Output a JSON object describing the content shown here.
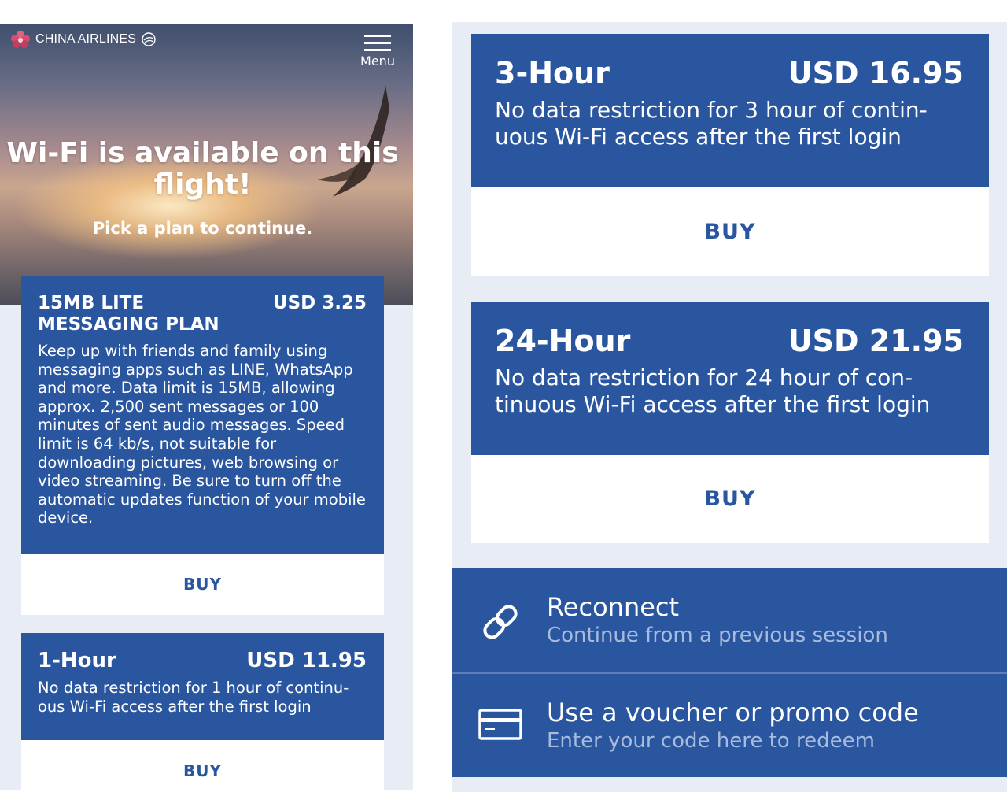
{
  "app": {
    "brand": "CHINA AIRLINES",
    "menu_label": "Menu"
  },
  "hero": {
    "title": "Wi-Fi is available on this flight!",
    "subtitle": "Pick a plan to continue."
  },
  "plans": [
    {
      "name": "15MB LITE MESSAGING PLAN",
      "price": "USD 3.25",
      "description": "Keep up with friends and family using messaging apps such as LINE, WhatsApp and more. Data limit is 15MB, allowing approx. 2,500 sent messages or 100 minutes of sent audio messages. Speed limit is 64 kb/s, not suitable for downloading pictures, web browsing or video streaming. Be sure to turn off the automatic updates function of your mobile device.",
      "buy_label": "BUY"
    },
    {
      "name": "1-Hour",
      "price": "USD 11.95",
      "description": "No data restriction for 1 hour of continu-ous Wi-Fi access after the first login",
      "buy_label": "BUY"
    },
    {
      "name": "3-Hour",
      "price": "USD 16.95",
      "description": "No data restriction for 3 hour of contin-uous Wi-Fi access after the first login",
      "buy_label": "BUY"
    },
    {
      "name": "24-Hour",
      "price": "USD 21.95",
      "description": "No data restriction for 24 hour of con-tinuous Wi-Fi access after the first login",
      "buy_label": "BUY"
    }
  ],
  "actions": {
    "reconnect": {
      "title": "Reconnect",
      "subtitle": "Continue from a previous session",
      "icon": "link-icon"
    },
    "voucher": {
      "title": "Use a voucher or promo code",
      "subtitle": "Enter your code here to redeem",
      "icon": "card-icon"
    }
  },
  "colors": {
    "primary": "#2a56a0",
    "panel_bg": "#e8edf5",
    "subtitle": "#a7bbdd"
  }
}
